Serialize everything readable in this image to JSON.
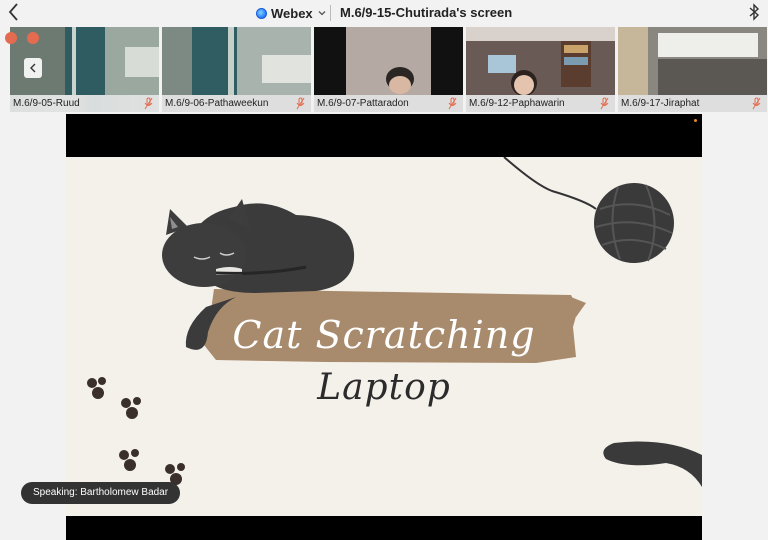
{
  "topbar": {
    "app_name": "Webex",
    "share_title": "M.6/9-15-Chutirada's screen"
  },
  "participants": [
    {
      "name": "M.6/9-05-Ruud"
    },
    {
      "name": "M.6/9-06-Pathaweekun"
    },
    {
      "name": "M.6/9-07-Pattaradon"
    },
    {
      "name": "M.6/9-12-Paphawarin"
    },
    {
      "name": "M.6/9-17-Jiraphat"
    }
  ],
  "slide": {
    "title": "Cat Scratching",
    "subtitle": "Laptop"
  },
  "status": {
    "speaking": "Speaking: Bartholomew Badar"
  },
  "colors": {
    "accent": "#2f86ff",
    "muted_mic": "#e46b4f",
    "slide_bg": "#f4f1eb",
    "brush": "#a88b6c"
  }
}
